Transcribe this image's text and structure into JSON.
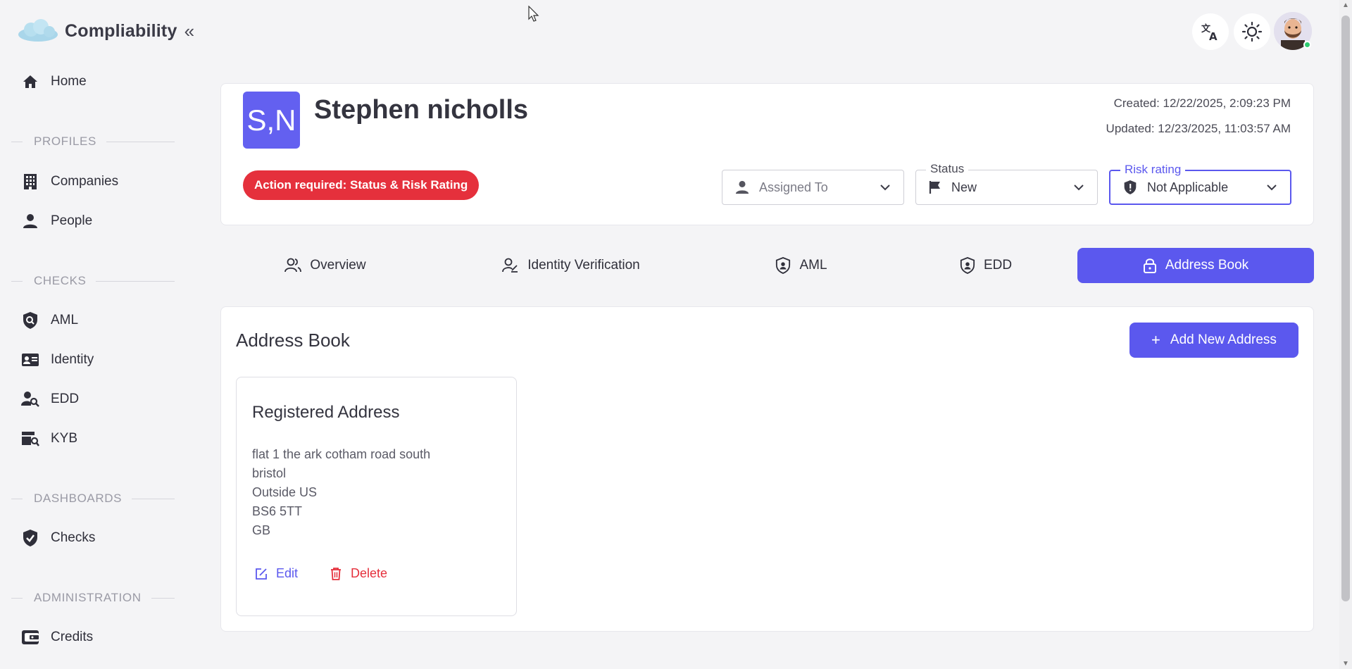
{
  "app": {
    "name": "Compliability"
  },
  "colors": {
    "accent": "#5b58ee",
    "danger": "#e5303c",
    "avatar_tile": "#6360f0",
    "online": "#2ecc71"
  },
  "sidebar": {
    "home": "Home",
    "sections": {
      "profiles": "PROFILES",
      "checks": "CHECKS",
      "dashboards": "DASHBOARDS",
      "administration": "ADMINISTRATION"
    },
    "items": {
      "companies": "Companies",
      "people": "People",
      "aml": "AML",
      "identity": "Identity",
      "edd": "EDD",
      "kyb": "KYB",
      "checks": "Checks",
      "credits": "Credits"
    }
  },
  "header_icons": [
    "translate-icon",
    "theme-toggle-icon",
    "user-avatar"
  ],
  "profile": {
    "initials": "S,N",
    "name": "Stephen nicholls",
    "created": "Created: 12/22/2025, 2:09:23 PM",
    "updated": "Updated: 12/23/2025, 11:03:57 AM",
    "badge": "Action required: Status & Risk Rating",
    "assigned_to": {
      "value": "Assigned To"
    },
    "status": {
      "legend": "Status",
      "value": "New"
    },
    "risk_rating": {
      "legend": "Risk rating",
      "value": "Not Applicable"
    }
  },
  "tabs": {
    "overview": "Overview",
    "identity_verification": "Identity Verification",
    "aml": "AML",
    "edd": "EDD",
    "address_book": "Address Book",
    "active": "address_book"
  },
  "address_book": {
    "title": "Address Book",
    "add_button": "Add New Address",
    "cards": [
      {
        "title": "Registered Address",
        "lines": [
          "flat 1 the ark cotham road south",
          "bristol",
          "Outside US",
          "BS6 5TT",
          "GB"
        ],
        "edit": "Edit",
        "delete": "Delete"
      }
    ]
  }
}
